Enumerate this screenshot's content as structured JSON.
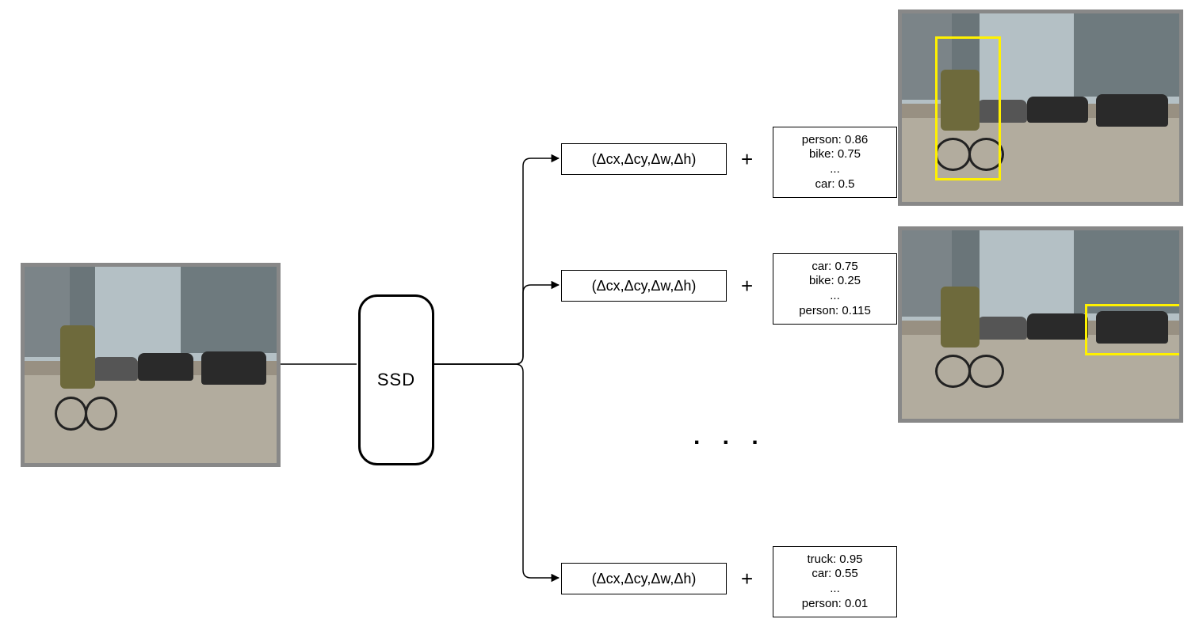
{
  "ssd_label": "SSD",
  "delta_label": "(Δcx,Δcy,Δw,Δh)",
  "plus": "+",
  "ellipsis_output": "...",
  "ellipsis_pipeline": ". . .",
  "predictions": [
    {
      "lines": [
        "person: 0.86",
        "bike: 0.75",
        "...",
        "car: 0.5"
      ]
    },
    {
      "lines": [
        "car: 0.75",
        "bike: 0.25",
        "...",
        "person: 0.115"
      ]
    },
    {
      "lines": [
        "truck: 0.95",
        "car:  0.55",
        "...",
        "person: 0.01"
      ]
    }
  ],
  "chart_data": {
    "type": "diagram",
    "model": "SSD",
    "input": "street scene photo (cyclist with flower basket, parked cars, urban background)",
    "per_detection_output": "(Δcx, Δcy, Δw, Δh) + class confidence scores",
    "detections": [
      {
        "scores": {
          "person": 0.86,
          "bike": 0.75,
          "car": 0.5
        },
        "top_class": "person",
        "bbox_description": "tall yellow box around cyclist on left side of image"
      },
      {
        "scores": {
          "car": 0.75,
          "bike": 0.25,
          "person": 0.115
        },
        "top_class": "car",
        "bbox_description": "yellow box around black car on right side of image"
      },
      {
        "scores": {
          "truck": 0.95,
          "car": 0.55,
          "person": 0.01
        },
        "top_class": "truck",
        "bbox_description": "not shown (ellipsis … additional detections)"
      }
    ],
    "note": "Pipeline diagram: input image → SSD → many (bbox-offset, class-score) pairs → visualized detections"
  }
}
